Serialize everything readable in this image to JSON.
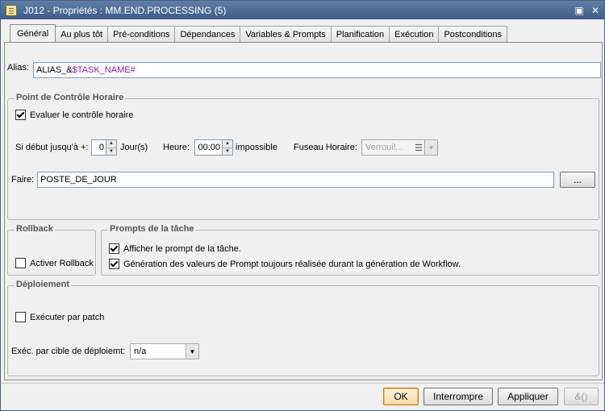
{
  "window": {
    "title": "J012 - Propriétés : MM.END.PROCESSING (5)",
    "restore_glyph": "▣",
    "close_glyph": "✕"
  },
  "tabs": [
    {
      "label": "Général",
      "active": true
    },
    {
      "label": "Au plus tôt"
    },
    {
      "label": "Pré-conditions"
    },
    {
      "label": "Dépendances"
    },
    {
      "label": "Variables & Prompts"
    },
    {
      "label": "Planification"
    },
    {
      "label": "Exécution"
    },
    {
      "label": "Postconditions"
    }
  ],
  "alias": {
    "label": "Alias:",
    "value_part1": "ALIAS_&",
    "value_part2": "$TASK_NAME#"
  },
  "time_checkpoint": {
    "title": "Point de Contrôle Horaire",
    "evaluate_label": "Evaluer le contrôle horaire",
    "evaluate_checked": true,
    "start_label": "Si début jusqu'à +:",
    "days_value": "0",
    "days_unit": "Jour(s)",
    "hour_label": "Heure:",
    "hour_value": "00:00",
    "impossible_label": "impossible",
    "timezone_label": "Fuseau Horaire:",
    "timezone_value": "Verrouil...",
    "do_label": "Faire:",
    "do_value": "POSTE_DE_JOUR",
    "browse_label": "..."
  },
  "rollback": {
    "title": "Rollback",
    "activate_label": "Activer Rollback",
    "activate_checked": false
  },
  "task_prompts": {
    "title": "Prompts de la tâche",
    "show_prompt_label": "Afficher le prompt de la tâche.",
    "show_prompt_checked": true,
    "generation_label": "Génération des valeurs de Prompt toujours réalisée durant la génération de Workflow.",
    "generation_checked": true
  },
  "deployment": {
    "title": "Déploiement",
    "execute_patch_label": "Exécuter par patch",
    "execute_patch_checked": false,
    "per_target_label": "Exéc. par cible de déploiemt:",
    "per_target_value": "n/a"
  },
  "footer": {
    "ok_label": "OK",
    "interrupt_label": "Interrompre",
    "apply_label": "Appliquer",
    "extra_glyph": "&()"
  },
  "icons": {
    "spin_up": "▲",
    "spin_down": "▼",
    "dropdown": "▼",
    "list": "☰"
  }
}
